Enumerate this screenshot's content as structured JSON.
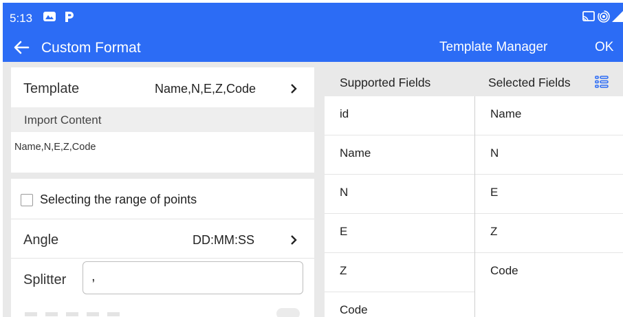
{
  "status": {
    "time": "5:13"
  },
  "app_bar": {
    "title": "Custom Format",
    "template_manager": "Template Manager",
    "ok": "OK"
  },
  "form": {
    "template_label": "Template",
    "template_value": "Name,N,E,Z,Code",
    "import_label": "Import Content",
    "import_content": "Name,N,E,Z,Code",
    "range_label": "Selecting the range of points",
    "angle_label": "Angle",
    "angle_value": "DD:MM:SS",
    "splitter_label": "Splitter",
    "splitter_value": ","
  },
  "fields": {
    "supported_header": "Supported Fields",
    "selected_header": "Selected Fields",
    "supported": [
      "id",
      "Name",
      "N",
      "E",
      "Z",
      "Code"
    ],
    "selected": [
      "Name",
      "N",
      "E",
      "Z",
      "Code"
    ]
  },
  "colors": {
    "accent": "#2c6cf5"
  }
}
